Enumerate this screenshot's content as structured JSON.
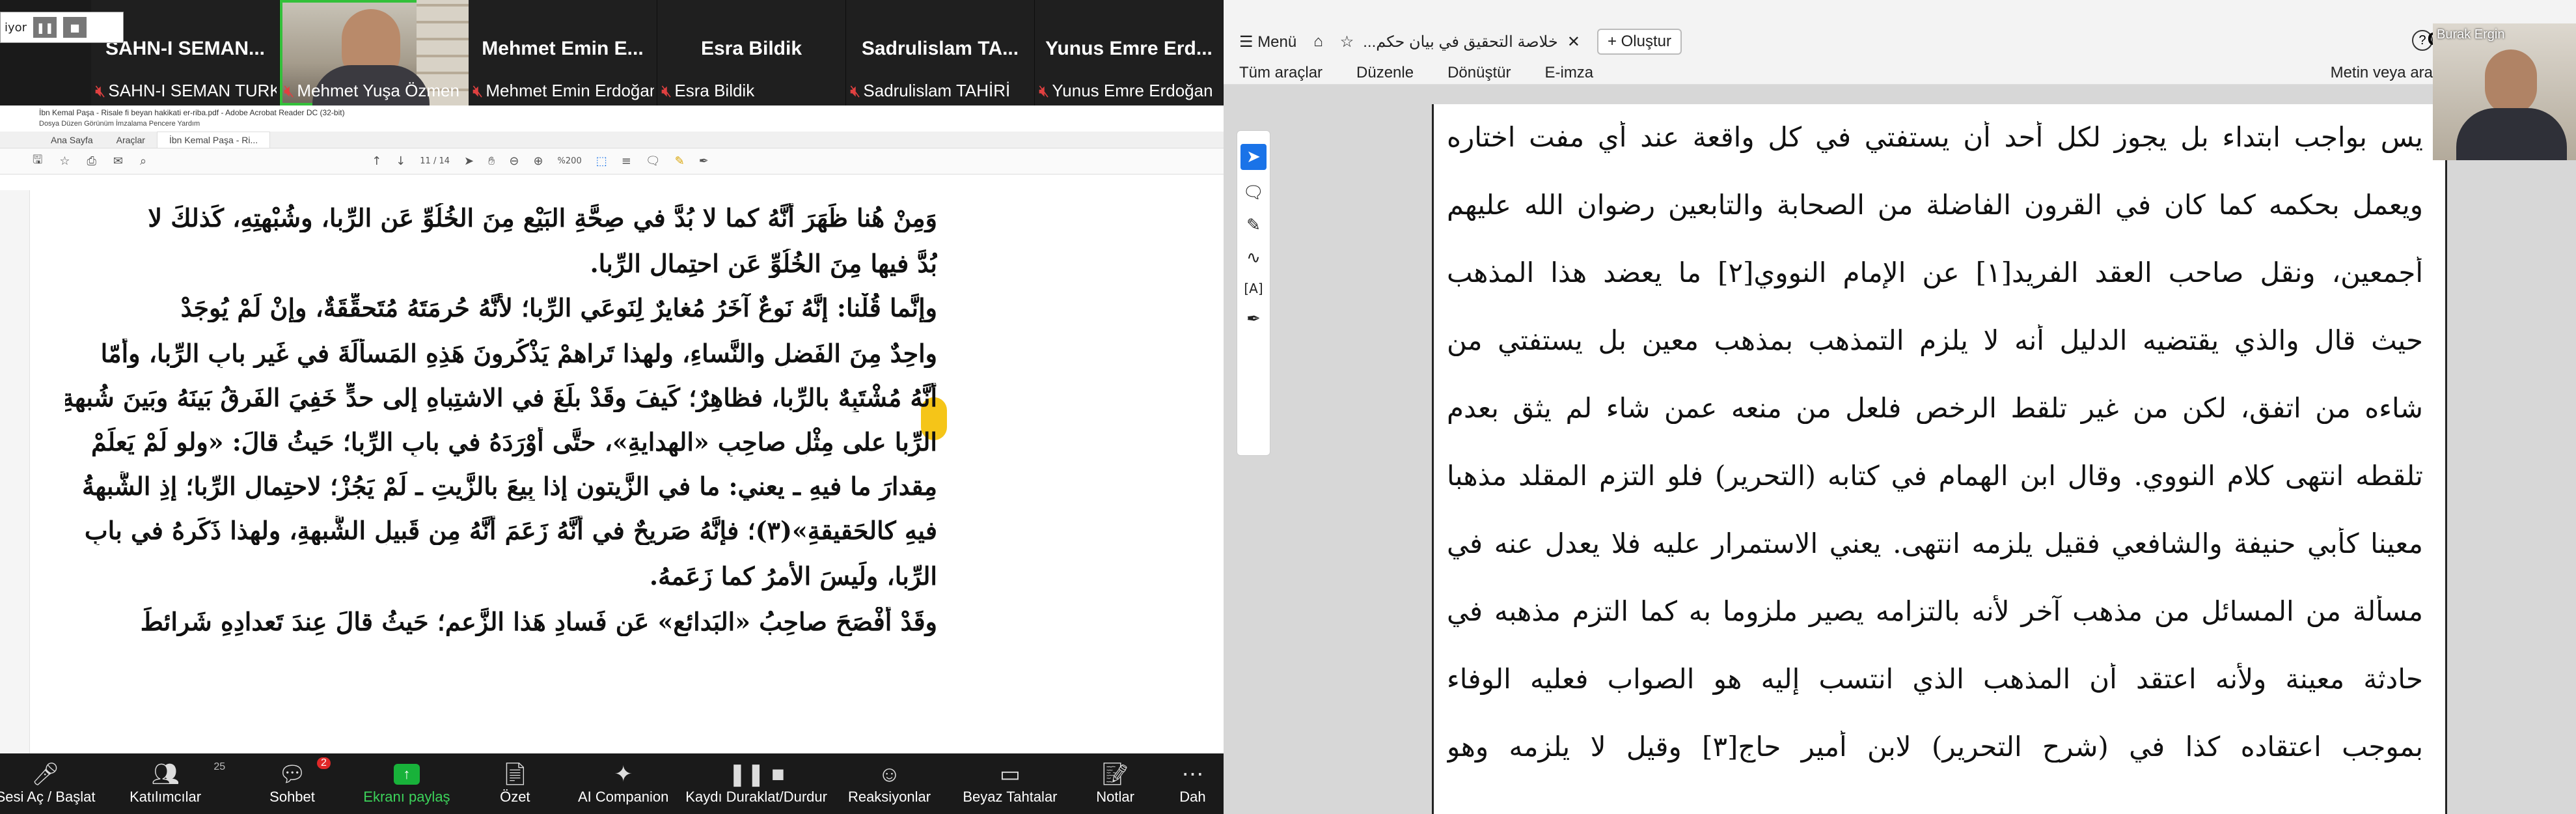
{
  "participants": [
    {
      "name": "SAHN-I SEMAN...",
      "label": "SAHN-I SEMAN TURKCE",
      "video": false
    },
    {
      "name": "",
      "label": "Mehmet Yuşa Özmen",
      "video": true
    },
    {
      "name": "Mehmet Emin E...",
      "label": "Mehmet Emin Erdoğan",
      "video": false
    },
    {
      "name": "Esra Bildik",
      "label": "Esra Bildik",
      "video": false
    },
    {
      "name": "Sadrulislam TA...",
      "label": "Sadrulislam TAHİRİ",
      "video": false
    },
    {
      "name": "Yunus Emre Erd...",
      "label": "Yunus Emre Erdoğan",
      "video": false
    }
  ],
  "acrobat": {
    "title": "İbn Kemal Paşa - Risale fi beyan hakikati er-riba.pdf - Adobe Acrobat Reader DC (32-bit)",
    "menu": "Dosya   Düzen   Görünüm   İmzalama   Pencere   Yardım",
    "tabs": [
      "Ana Sayfa",
      "Araçlar",
      "İbn Kemal Paşa - Ri..."
    ],
    "page_indicator": "11 / 14",
    "zoom": "%200",
    "presenter_label": "iyor"
  },
  "left_doc_lines": [
    "وَمِنْ هُنا ظَهَرَ أنَّهُ كما لا بُدَّ في صِحَّةِ البَيْعِ مِنَ الخُلُوِّ عَنِ الرِّبا، وشُبْهتِهِ، كَذلكَ لا",
    "بُدَّ فيها مِنَ الخُلُوِّ عَنِ احتِمالِ الرِّبا.",
    "وإنَّما قُلْنا: إنَّهُ نَوعٌ آخَرُ مُغايرٌ لِنَوعَي الرِّبا؛ لأنَّهُ حُرمَتَهُ مُتَحقِّقَةٌ، وإنْ لَمْ يُوجَدْ",
    "واحِدٌ مِنَ الفَضلِ والنَّساءِ، ولهذا تَراهمْ يَذْكُرونَ هَذِهِ المَسألَةَ في غَيرِ بابِ الرِّبا، وأمّا",
    "أنَّهُ مُشْتَبِهٌ بالرِّبا، فظاهِرٌ؛ كَيفَ وقَدْ بلَغَ في الاشتِباهِ إلى حدٍّ خَفِيَ الفَرقُ بَينَهُ وبَينَ شُبهةِ",
    "الرِّبا على مِثْلِ صاحِبِ «الهِدايةِ»، حتَّى أوْرَدَهُ في بابِ الرِّبا؛ حَيثُ قالَ: «ولو لَمْ يَعلَمْ",
    "مِقدارَ ما فيهِ ـ يعني: ما في الزَّيتونِ إذا بِيعَ بالزَّيتِ ـ لَمْ يَجُزْ؛ لاحتِمالِ الرِّبا؛ إذِ الشُّبهةُ",
    "فيهِ كالحَقيقةِ»(٣)؛ فإنَّهُ صَريحٌ في أنَّهُ زَعَمَ أنَّهُ مِن قَبيلِ الشُّبهةِ، ولهذا ذَكَرهُ في بابِ",
    "الرِّبا، ولَيسَ الأمرُ كما زَعَمهُ.",
    "وقَدْ أفْصَحَ صاحِبُ «البَدائعِ» عَن فَسادِ هَذا الزَّعمِ؛ حَيثُ قالَ عِندَ تَعدادِهِ شَرائطَ"
  ],
  "zoom_toolbar": [
    {
      "label": "Sesi Aç / Başlat",
      "icon": "microphone-icon"
    },
    {
      "label": "Katılımcılar",
      "icon": "participants-icon",
      "count": "25"
    },
    {
      "label": "Sohbet",
      "icon": "chat-icon",
      "badge": "2"
    },
    {
      "label": "Ekranı paylaş",
      "icon": "share-screen-icon"
    },
    {
      "label": "Özet",
      "icon": "summary-icon"
    },
    {
      "label": "AI Companion",
      "icon": "ai-companion-icon"
    },
    {
      "label": "Kaydı Duraklat/Durdur",
      "icon": "record-pause-icon"
    },
    {
      "label": "Reaksiyonlar",
      "icon": "reactions-icon"
    },
    {
      "label": "Beyaz Tahtalar",
      "icon": "whiteboard-icon"
    },
    {
      "label": "Notlar",
      "icon": "notes-icon"
    },
    {
      "label": "Dah",
      "icon": "more-icon"
    }
  ],
  "browser": {
    "menu_label": "Menü",
    "tab_title": "خلاصة التحقيق في بيان حكم...",
    "new_button": "Oluştur",
    "signin": "Giri",
    "toolbar": [
      "Tüm araçlar",
      "Düzenle",
      "Dönüştür",
      "E-imza"
    ],
    "search_text": "Metin veya ara",
    "webcam_name": "Burak Ergin"
  },
  "right_doc_lines": [
    "يس بواجب ابتداء بل يجوز لكل أحد أن يستفتي في كل واقعة عند أي مفت اختاره",
    "ويعمل بحكمه كما كان في القرون الفاضلة من الصحابة والتابعين رضوان الله عليهم",
    "أجمعين، ونقل صاحب العقد الفريد[١] عن الإمام النووي[٢] ما يعضد هذا المذهب",
    "حيث قال والذي يقتضيه الدليل أنه لا يلزم التمذهب بمذهب معين بل يستفتي من",
    "شاءه من اتفق، لكن من غير تلقط الرخص فلعل من منعه عمن شاء لم يثق بعدم",
    "تلقطه انتهى كلام النووي. وقال ابن الهمام في كتابه (التحرير) فلو التزم المقلد مذهبا",
    "معينا كأبي حنيفة والشافعي فقيل يلزمه انتهى. يعني الاستمرار عليه فلا يعدل عنه في",
    "مسألة من المسائل من مذهب آخر لأنه بالتزامه يصير ملزوما به كما التزم مذهبه في",
    "حادثة معينة ولأنه اعتقد أن المذهب الذي انتسب إليه هو الصواب فعليه الوفاء",
    "بموجب اعتقاده كذا في (شرح التحرير) لابن أمير حاج[٣] وقيل لا يلزمه وهو"
  ]
}
